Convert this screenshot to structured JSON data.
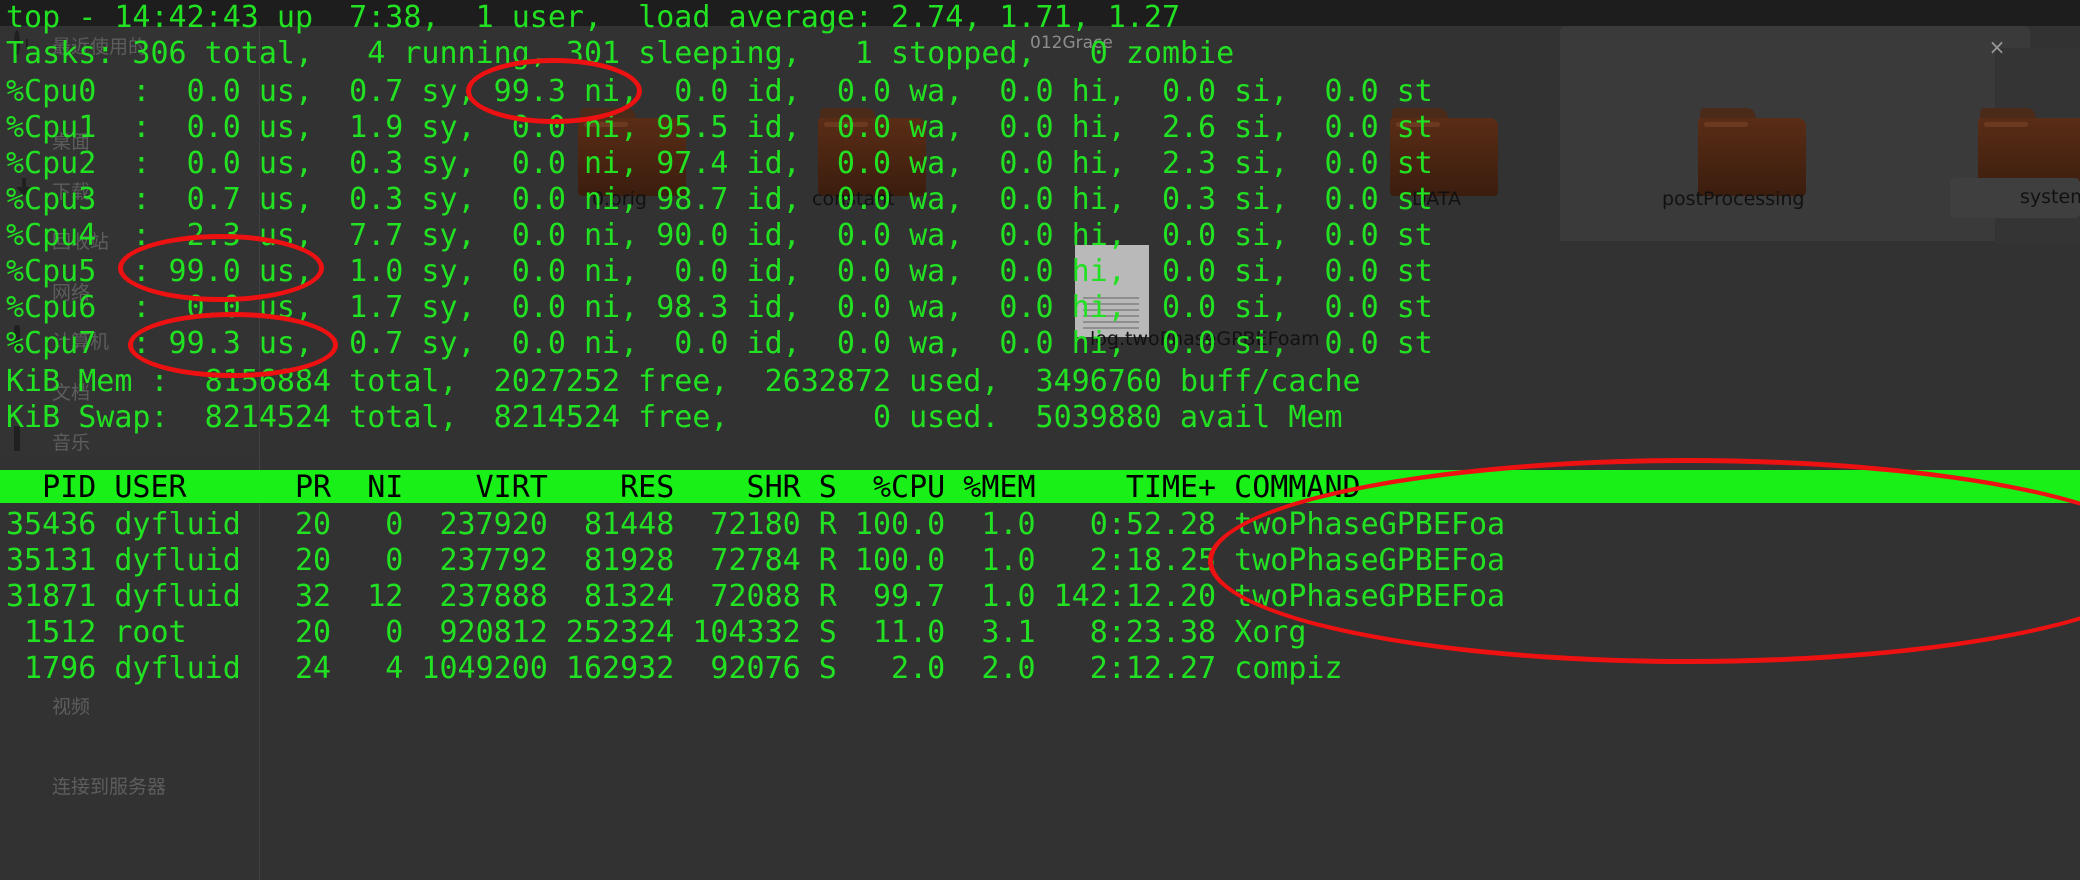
{
  "window": {
    "bg_tab_label": "012Grace",
    "close_label": "×"
  },
  "sidebar": {
    "items": [
      {
        "label": "最近使用的",
        "icon": "clock-icon"
      },
      {
        "label": "",
        "icon": "home-icon"
      },
      {
        "label": "桌面",
        "icon": "desktop-icon"
      },
      {
        "label": "下载",
        "icon": "download-icon"
      },
      {
        "label": "回收站",
        "icon": "trash-icon"
      },
      {
        "label": "网络",
        "icon": "network-icon"
      },
      {
        "label": "计算机",
        "icon": "computer-icon"
      },
      {
        "label": "文档",
        "icon": "document-icon"
      },
      {
        "label": "音乐",
        "icon": "music-icon"
      },
      {
        "label": "视频",
        "icon": "video-icon"
      },
      {
        "label": "连接到服务器",
        "icon": "server-icon"
      }
    ]
  },
  "desktop_files": [
    {
      "name": "0.orig",
      "type": "folder"
    },
    {
      "name": "constant",
      "type": "folder"
    },
    {
      "name": "DATA",
      "type": "folder"
    },
    {
      "name": "postProcessing",
      "type": "folder"
    },
    {
      "name": "system",
      "type": "folder"
    },
    {
      "name": "log.twoPhaseGPBEFoam",
      "type": "file"
    }
  ],
  "terminal": {
    "summary_lines": [
      "top - 14:42:43 up  7:38,  1 user,  load average: 2.74, 1.71, 1.27",
      "Tasks: 306 total,   4 running, 301 sleeping,   1 stopped,   0 zombie",
      "%Cpu0  :  0.0 us,  0.7 sy, 99.3 ni,  0.0 id,  0.0 wa,  0.0 hi,  0.0 si,  0.0 st",
      "%Cpu1  :  0.0 us,  1.9 sy,  0.0 ni, 95.5 id,  0.0 wa,  0.0 hi,  2.6 si,  0.0 st",
      "%Cpu2  :  0.0 us,  0.3 sy,  0.0 ni, 97.4 id,  0.0 wa,  0.0 hi,  2.3 si,  0.0 st",
      "%Cpu3  :  0.7 us,  0.3 sy,  0.0 ni, 98.7 id,  0.0 wa,  0.0 hi,  0.3 si,  0.0 st",
      "%Cpu4  :  2.3 us,  7.7 sy,  0.0 ni, 90.0 id,  0.0 wa,  0.0 hi,  0.0 si,  0.0 st",
      "%Cpu5  : 99.0 us,  1.0 sy,  0.0 ni,  0.0 id,  0.0 wa,  0.0 hi,  0.0 si,  0.0 st",
      "%Cpu6  :  0.0 us,  1.7 sy,  0.0 ni, 98.3 id,  0.0 wa,  0.0 hi,  0.0 si,  0.0 st",
      "%Cpu7  : 99.3 us,  0.7 sy,  0.0 ni,  0.0 id,  0.0 wa,  0.0 hi,  0.0 si,  0.0 st",
      "KiB Mem :  8156884 total,  2027252 free,  2632872 used,  3496760 buff/cache",
      "KiB Swap:  8214524 total,  8214524 free,        0 used.  5039880 avail Mem"
    ],
    "header_row": "  PID USER      PR  NI    VIRT    RES    SHR S  %CPU %MEM     TIME+ COMMAND",
    "process_rows": [
      "35436 dyfluid   20   0  237920  81448  72180 R 100.0  1.0   0:52.28 twoPhaseGPBEFoa",
      "35131 dyfluid   20   0  237792  81928  72784 R 100.0  1.0   2:18.25 twoPhaseGPBEFoa",
      "31871 dyfluid   32  12  237888  81324  72088 R  99.7  1.0 142:12.20 twoPhaseGPBEFoa",
      " 1512 root      20   0  920812 252324 104332 S  11.0  3.1   8:23.38 Xorg",
      " 1796 dyfluid   24   4 1049200 162932  92076 S   2.0  2.0   2:12.27 compiz"
    ],
    "load_average": {
      "one_min": "2.74",
      "five_min": "1.71",
      "fifteen_min": "1.27"
    },
    "uptime": "7:38",
    "clock": "14:42:43",
    "users": "1",
    "tasks": {
      "total": "306",
      "running": "4",
      "sleeping": "301",
      "stopped": "1",
      "zombie": "0"
    },
    "memory": {
      "mem_total": "8156884",
      "mem_free": "2027252",
      "mem_used": "2632872",
      "buff_cache": "3496760",
      "swap_total": "8214524",
      "swap_free": "8214524",
      "swap_used": "0",
      "avail_mem": "5039880"
    },
    "columns": [
      "PID",
      "USER",
      "PR",
      "NI",
      "VIRT",
      "RES",
      "SHR",
      "S",
      "%CPU",
      "%MEM",
      "TIME+",
      "COMMAND"
    ],
    "processes": [
      {
        "pid": "35436",
        "user": "dyfluid",
        "pr": "20",
        "ni": "0",
        "virt": "237920",
        "res": "81448",
        "shr": "72180",
        "s": "R",
        "cpu": "100.0",
        "mem": "1.0",
        "time": "0:52.28",
        "command": "twoPhaseGPBEFoa"
      },
      {
        "pid": "35131",
        "user": "dyfluid",
        "pr": "20",
        "ni": "0",
        "virt": "237792",
        "res": "81928",
        "shr": "72784",
        "s": "R",
        "cpu": "100.0",
        "mem": "1.0",
        "time": "2:18.25",
        "command": "twoPhaseGPBEFoa"
      },
      {
        "pid": "31871",
        "user": "dyfluid",
        "pr": "32",
        "ni": "12",
        "virt": "237888",
        "res": "81324",
        "shr": "72088",
        "s": "R",
        "cpu": "99.7",
        "mem": "1.0",
        "time": "142:12.20",
        "command": "twoPhaseGPBEFoa"
      },
      {
        "pid": "1512",
        "user": "root",
        "pr": "20",
        "ni": "0",
        "virt": "920812",
        "res": "252324",
        "shr": "104332",
        "s": "S",
        "cpu": "11.0",
        "mem": "3.1",
        "time": "8:23.38",
        "command": "Xorg"
      },
      {
        "pid": "1796",
        "user": "dyfluid",
        "pr": "24",
        "ni": "4",
        "virt": "1049200",
        "res": "162932",
        "shr": "92076",
        "s": "S",
        "cpu": "2.0",
        "mem": "2.0",
        "time": "2:12.27",
        "command": "compiz"
      }
    ]
  },
  "annotations": {
    "color": "#ee1111",
    "highlights": [
      "99.3 ni (Cpu0)",
      "99.0 us (Cpu5)",
      "99.3 us (Cpu7)",
      "COMMAND twoPhaseGPBEFoa column"
    ]
  },
  "colors": {
    "terminal_text": "#22e022",
    "terminal_bold": "#12e512",
    "header_bg": "#18f018",
    "header_text": "#000000",
    "background": "#323232",
    "annotation": "#ee1111"
  }
}
